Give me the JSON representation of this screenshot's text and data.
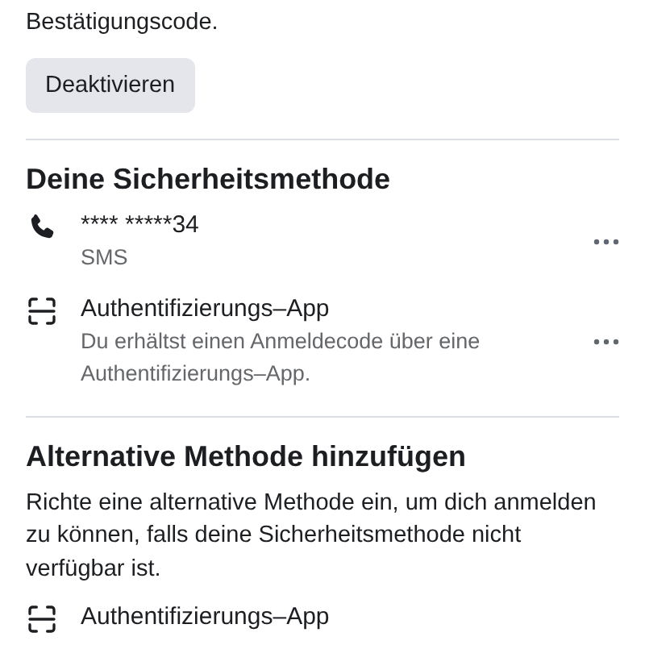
{
  "intro_text": "Bestätigungscode.",
  "deactivate_button": "Deaktivieren",
  "security_method": {
    "title": "Deine Sicherheitsmethode",
    "methods": [
      {
        "kind": "phone",
        "title": "**** *****34",
        "subtitle": "SMS",
        "has_menu": true
      },
      {
        "kind": "app",
        "title": "Authentifizierungs–App",
        "subtitle": "Du erhältst einen Anmeldecode über eine Authentifizierungs–App.",
        "has_menu": true
      }
    ]
  },
  "alternative": {
    "title": "Alternative Methode hinzufügen",
    "description": "Richte eine alternative Methode ein, um dich anmelden zu können, falls deine Sicherheitsmethode nicht verfügbar ist.",
    "methods": [
      {
        "kind": "app",
        "title": "Authentifizierungs–App"
      }
    ]
  }
}
